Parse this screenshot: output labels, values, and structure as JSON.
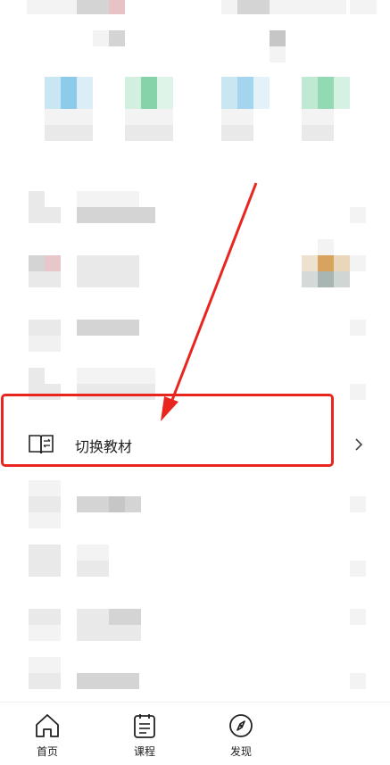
{
  "menu": {
    "switch_textbook_label": "切换教材"
  },
  "icons": {
    "book": "book-swap-icon",
    "chevron": "chevron-right-icon",
    "home": "home-icon",
    "course": "course-list-icon",
    "discover": "compass-icon"
  },
  "tabs": [
    {
      "label": "首页"
    },
    {
      "label": "课程"
    },
    {
      "label": "发现"
    }
  ],
  "colors": {
    "highlight": "#e8251f",
    "text": "#222222"
  }
}
